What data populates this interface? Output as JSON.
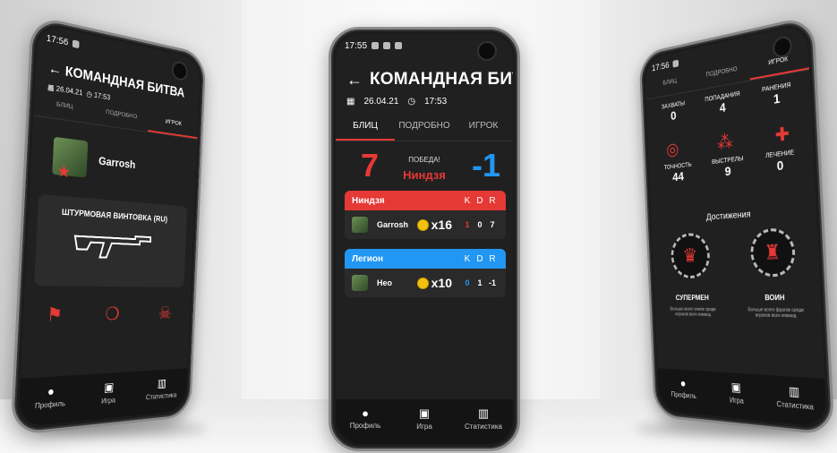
{
  "colors": {
    "accent": "#e53935",
    "blue": "#2196f3",
    "bg": "#202020"
  },
  "center": {
    "status_time": "17:55",
    "title": "КОМАНДНАЯ БИТВА",
    "date": "26.04.21",
    "time": "17:53",
    "tabs": [
      "БЛИЦ",
      "ПОДРОБНО",
      "ИГРОК"
    ],
    "score_left": "7",
    "score_right": "-1",
    "verdict": "ПОБЕДА!",
    "winner": "Ниндзя",
    "teams": [
      {
        "name": "Ниндзя",
        "color": "#e53935",
        "cols": [
          "K",
          "D",
          "R"
        ],
        "players": [
          {
            "name": "Garrosh",
            "mult": "x16",
            "k": "1",
            "d": "0",
            "r": "7",
            "k_color": "#e53935"
          }
        ]
      },
      {
        "name": "Легион",
        "color": "#2196f3",
        "cols": [
          "K",
          "D",
          "R"
        ],
        "players": [
          {
            "name": "Нео",
            "mult": "x10",
            "k": "0",
            "d": "1",
            "r": "-1",
            "k_color": "#2196f3"
          }
        ]
      }
    ],
    "nav": [
      "Профиль",
      "Игра",
      "Статистика"
    ]
  },
  "left": {
    "status_time": "17:56",
    "title": "КОМАНДНАЯ БИТВА",
    "date": "26.04.21",
    "time": "17:53",
    "tabs": [
      "БЛИЦ",
      "ПОДРОБНО",
      "ИГРОК"
    ],
    "player": "Garrosh",
    "rank": "1",
    "weapon": "ШТУРМОВАЯ ВИНТОВКА (RU)",
    "nav": [
      "Профиль",
      "Игра",
      "Статистика"
    ]
  },
  "right": {
    "status_time": "17:56",
    "tabs": [
      "БЛИЦ",
      "ПОДРОБНО",
      "ИГРОК"
    ],
    "row1": [
      {
        "label": "ЗАХВАТЫ",
        "value": "0"
      },
      {
        "label": "ПОПАДАНИЯ",
        "value": "4"
      },
      {
        "label": "РАНЕНИЯ",
        "value": "1"
      }
    ],
    "row2": [
      {
        "label": "ТОЧНОСТЬ",
        "value": "44"
      },
      {
        "label": "ВЫСТРЕЛЫ",
        "value": "9"
      },
      {
        "label": "ЛЕЧЕНИЕ",
        "value": "0"
      }
    ],
    "achievements_title": "Достижения",
    "badges": [
      {
        "title": "СУПЕРМЕН",
        "desc": "Больше всего очков среди игроков всех команд"
      },
      {
        "title": "ВОИН",
        "desc": "Больше всего фрагов среди игроков всех команд"
      }
    ],
    "nav": [
      "Профиль",
      "Игра",
      "Статистика"
    ]
  }
}
